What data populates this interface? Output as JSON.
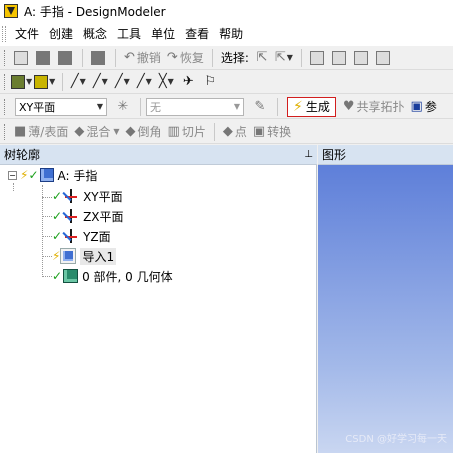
{
  "window": {
    "title": "A: 手指 - DesignModeler"
  },
  "menu": [
    "文件",
    "创建",
    "概念",
    "工具",
    "单位",
    "查看",
    "帮助"
  ],
  "toolbar1": {
    "undo": "撤销",
    "redo": "恢复",
    "select_label": "选择:"
  },
  "toolbar3": {
    "plane_select": "XY平面",
    "sketch_select": "无",
    "generate": "生成",
    "share_topology": "共享拓扑",
    "params": "参"
  },
  "toolbar4": {
    "thin_surface": "薄/表面",
    "blend": "混合",
    "chamfer": "倒角",
    "slice": "切片",
    "point": "点",
    "convert": "转换"
  },
  "tree": {
    "header": "树轮廓",
    "pin": "📌",
    "root": "A: 手指",
    "items": [
      "XY平面",
      "ZX平面",
      "YZ面",
      "导入1",
      "0 部件, 0 几何体"
    ]
  },
  "graphics": {
    "header": "图形",
    "watermark": "CSDN @好学习每一天"
  },
  "colors": {
    "panel_header": "#d7e3f1",
    "generate_border": "#d21e1e",
    "graphics_top": "#5e7fd9",
    "graphics_bottom": "#c9d6f1"
  }
}
